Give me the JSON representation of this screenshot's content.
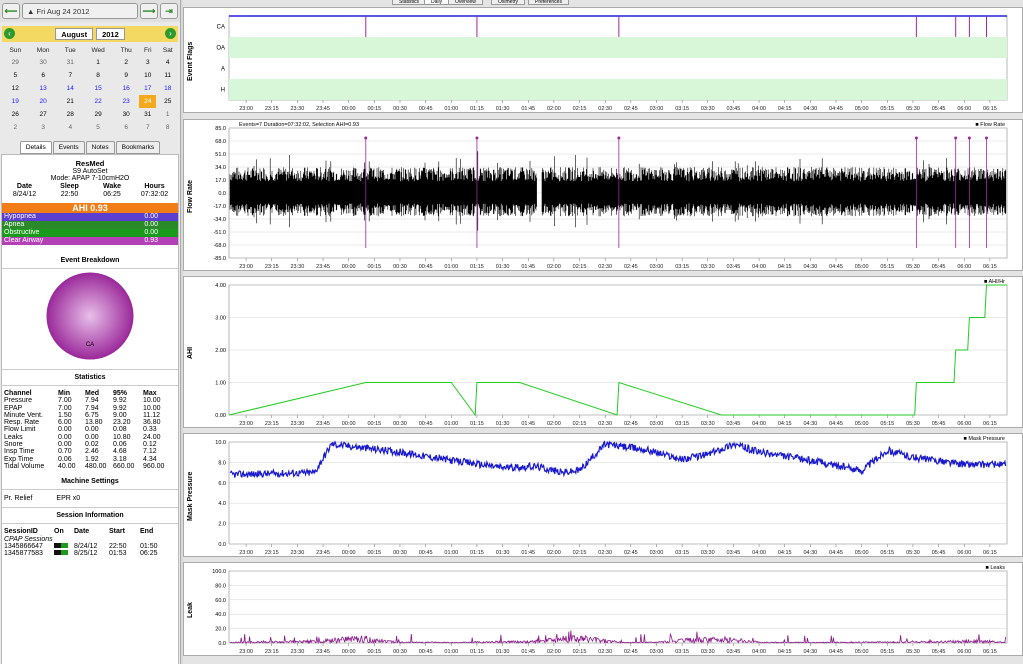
{
  "toolbar_tabs": [
    "Statistics",
    "Daily",
    "Overview",
    "Oximetry",
    "Preferences"
  ],
  "nav": {
    "back_icon": "arrow-left-icon",
    "date_label": "▲ Fri Aug 24 2012",
    "forward_icon": "arrow-right-icon",
    "last_icon": "jump-end-icon"
  },
  "calendar": {
    "month": "August",
    "year": "2012",
    "weekdays": [
      "Sun",
      "Mon",
      "Tue",
      "Wed",
      "Thu",
      "Fri",
      "Sat"
    ],
    "weeks": [
      [
        "29",
        "30",
        "31",
        "1",
        "2",
        "3",
        "4"
      ],
      [
        "5",
        "6",
        "7",
        "8",
        "9",
        "10",
        "11"
      ],
      [
        "12",
        "13",
        "14",
        "15",
        "16",
        "17",
        "18"
      ],
      [
        "19",
        "20",
        "21",
        "22",
        "23",
        "24",
        "25"
      ],
      [
        "26",
        "27",
        "28",
        "29",
        "30",
        "31",
        "1"
      ],
      [
        "2",
        "3",
        "4",
        "5",
        "6",
        "7",
        "8"
      ]
    ],
    "selected": "24"
  },
  "side_tabs": [
    "Details",
    "Events",
    "Notes",
    "Bookmarks"
  ],
  "machine": {
    "brand": "ResMed",
    "model": "S9 AutoSet",
    "mode": "Mode: APAP 7-10cmH2O",
    "headers": [
      "Date",
      "Sleep",
      "Wake",
      "Hours"
    ],
    "values": [
      "8/24/12",
      "22:50",
      "06:25",
      "07:32:02"
    ]
  },
  "ahi": {
    "label": "AHI 0.93",
    "events": [
      {
        "name": "Hypopnea",
        "value": "0.00",
        "color": "#5a3fd0"
      },
      {
        "name": "Apnea",
        "value": "0.00",
        "color": "#2a8a2a"
      },
      {
        "name": "Obstructive",
        "value": "0.00",
        "color": "#1a9a1a"
      },
      {
        "name": "Clear Airway",
        "value": "0.93",
        "color": "#b341b5"
      }
    ]
  },
  "event_breakdown": {
    "title": "Event Breakdown",
    "pie_label": "CA",
    "pie_color": "#9b2a9b"
  },
  "statistics": {
    "title": "Statistics",
    "headers": [
      "Channel",
      "Min",
      "Med",
      "95%",
      "Max"
    ],
    "rows": [
      [
        "Pressure",
        "7.00",
        "7.94",
        "9.92",
        "10.00"
      ],
      [
        "EPAP",
        "7.00",
        "7.94",
        "9.92",
        "10.00"
      ],
      [
        "Minute Vent.",
        "1.50",
        "6.75",
        "9.00",
        "11.12"
      ],
      [
        "Resp. Rate",
        "6.00",
        "13.80",
        "23.20",
        "36.80"
      ],
      [
        "Flow Limit",
        "0.00",
        "0.00",
        "0.08",
        "0.33"
      ],
      [
        "Leaks",
        "0.00",
        "0.00",
        "10.80",
        "24.00"
      ],
      [
        "Snore",
        "0.00",
        "0.02",
        "0.06",
        "0.12"
      ],
      [
        "Insp Time",
        "0.70",
        "2.46",
        "4.68",
        "7.12"
      ],
      [
        "Exp Time",
        "0.06",
        "1.92",
        "3.18",
        "4.34"
      ],
      [
        "Tidal Volume",
        "40.00",
        "480.00",
        "660.00",
        "960.00"
      ]
    ]
  },
  "machine_settings": {
    "title": "Machine Settings",
    "label": "Pr. Relief",
    "value": "EPR x0"
  },
  "sessions": {
    "title": "Session Information",
    "headers": [
      "SessionID",
      "On",
      "Date",
      "Start",
      "End"
    ],
    "group": "CPAP Sessions",
    "rows": [
      [
        "1345866647",
        "8/24/12",
        "22:50",
        "01:50"
      ],
      [
        "1345877583",
        "8/25/12",
        "01:53",
        "06:25"
      ]
    ]
  },
  "time_ticks": [
    "23:00",
    "23:15",
    "23:30",
    "23:45",
    "00:00",
    "00:15",
    "00:30",
    "00:45",
    "01:00",
    "01:15",
    "01:30",
    "01:45",
    "02:00",
    "02:15",
    "02:30",
    "02:45",
    "03:00",
    "03:15",
    "03:30",
    "03:45",
    "04:00",
    "04:15",
    "04:30",
    "04:45",
    "05:00",
    "05:15",
    "05:30",
    "05:45",
    "06:00",
    "06:15"
  ],
  "chart_data": [
    {
      "type": "scatter",
      "title": "",
      "ylabel": "Event Flags",
      "categories": [
        "CA",
        "OA",
        "A",
        "H"
      ],
      "events_CA": [
        "00:10",
        "01:15",
        "02:38",
        "05:32",
        "05:55",
        "06:03",
        "06:13"
      ]
    },
    {
      "type": "line",
      "title": "Events=7 Duration=07:32:02, Selection AHI=0.93",
      "ylabel": "Flow Rate",
      "legend": "Flow Rate",
      "yticks": [
        "85.0",
        "68.0",
        "51.0",
        "34.0",
        "17.0",
        "0.0",
        "-17.0",
        "-34.0",
        "-51.0",
        "-68.0",
        "-85.0"
      ]
    },
    {
      "type": "line",
      "ylabel": "AHI",
      "legend": "AHI/Hr",
      "ylim": [
        0,
        4
      ],
      "yticks": [
        "4.00",
        "3.00",
        "2.00",
        "1.00",
        "0.00"
      ],
      "x": [
        "22:50",
        "00:10",
        "01:00",
        "01:14",
        "01:15",
        "01:40",
        "02:37",
        "02:38",
        "03:38",
        "05:31",
        "05:32",
        "05:54",
        "05:55",
        "06:02",
        "06:03",
        "06:12",
        "06:13",
        "06:25"
      ],
      "values": [
        0,
        1,
        1,
        0,
        1,
        1,
        0,
        1,
        0,
        0,
        1,
        1,
        2,
        2,
        3,
        3,
        4,
        4
      ]
    },
    {
      "type": "line",
      "ylabel": "Mask Pressure",
      "legend": "Mask Pressure",
      "ylim": [
        0,
        10
      ],
      "yticks": [
        "10.0",
        "8.0",
        "6.0",
        "4.0",
        "2.0",
        "0.0"
      ],
      "x": [
        "22:50",
        "23:40",
        "23:50",
        "00:30",
        "01:00",
        "01:30",
        "01:50",
        "02:05",
        "02:15",
        "02:30",
        "02:55",
        "03:15",
        "03:30",
        "03:45",
        "04:00",
        "04:30",
        "05:00",
        "05:15",
        "05:30",
        "06:00",
        "06:25"
      ],
      "values": [
        6.8,
        7.0,
        9.8,
        9.0,
        8.2,
        7.5,
        7.6,
        7.0,
        7.2,
        9.8,
        9.2,
        8.3,
        8.8,
        9.8,
        9.0,
        8.2,
        7.2,
        9.2,
        8.5,
        7.8,
        7.8
      ]
    },
    {
      "type": "line",
      "ylabel": "Leak",
      "legend": "Leaks",
      "ylim": [
        0,
        100
      ],
      "yticks": [
        "100.0",
        "80.0",
        "60.0",
        "40.0",
        "20.0",
        "0.0"
      ],
      "x": [
        "22:50",
        "23:30",
        "23:45",
        "00:00",
        "00:10",
        "00:30",
        "00:45",
        "01:00",
        "01:20",
        "01:45",
        "02:10",
        "02:25",
        "02:40",
        "03:00",
        "03:20",
        "03:40",
        "04:00",
        "04:30",
        "05:00",
        "05:30",
        "05:50",
        "06:10",
        "06:25"
      ],
      "values": [
        2,
        6,
        8,
        16,
        18,
        2,
        3,
        2,
        4,
        6,
        22,
        14,
        2,
        3,
        12,
        16,
        3,
        2,
        3,
        4,
        6,
        8,
        2
      ]
    }
  ]
}
